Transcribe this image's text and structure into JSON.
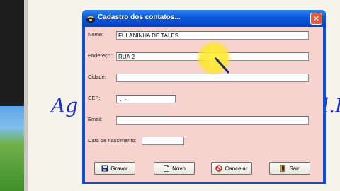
{
  "dialog": {
    "title": "Cadastro dos contatos...",
    "close_label": "✕"
  },
  "background": {
    "text_left": "Ag",
    "text_right": "l.L"
  },
  "form": {
    "nome_label": "Nome:",
    "nome_value": "FULANINHA DE TALES",
    "endereco_label": "Endereço:",
    "endereco_value": "RUA 2",
    "cidade_label": "Cidade:",
    "cidade_value": "",
    "cep_label": "CEP:",
    "cep_value": " .  -",
    "email_label": "Email:",
    "email_value": "",
    "nascimento_label": "Data de nascimento:",
    "nascimento_value": ""
  },
  "buttons": {
    "gravar": "Gravar",
    "novo": "Novo",
    "cancelar": "Cancelar",
    "sair": "Sair"
  },
  "icons": {
    "title": "contacts-phone-icon",
    "gravar": "floppy-disk-icon",
    "novo": "new-document-icon",
    "cancelar": "cancel-icon",
    "sair": "exit-door-icon"
  },
  "colors": {
    "title_bar": "#0b57d8",
    "form_background": "#f7d3cf",
    "background_text": "#1b2fd1",
    "cursor_highlight": "#ffe628"
  }
}
